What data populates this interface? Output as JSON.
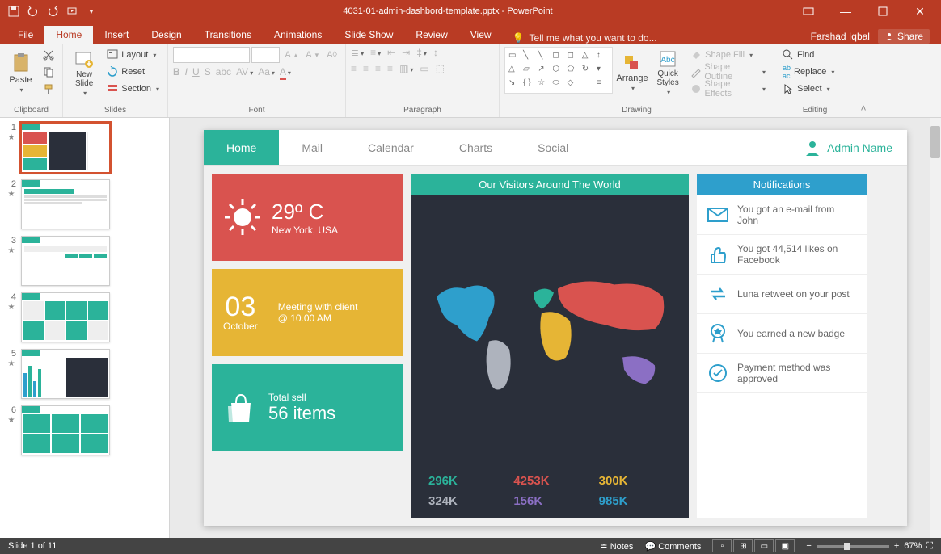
{
  "window": {
    "title": "4031-01-admin-dashbord-template.pptx - PowerPoint",
    "user": "Farshad Iqbal",
    "share": "Share"
  },
  "tabs": {
    "file": "File",
    "list": [
      "Home",
      "Insert",
      "Design",
      "Transitions",
      "Animations",
      "Slide Show",
      "Review",
      "View"
    ],
    "active": "Home",
    "tell_me": "Tell me what you want to do..."
  },
  "ribbon": {
    "clipboard": {
      "label": "Clipboard",
      "paste": "Paste"
    },
    "slides": {
      "label": "Slides",
      "new_slide": "New\nSlide",
      "layout": "Layout",
      "reset": "Reset",
      "section": "Section"
    },
    "font": {
      "label": "Font"
    },
    "paragraph": {
      "label": "Paragraph"
    },
    "drawing": {
      "label": "Drawing",
      "arrange": "Arrange",
      "quick_styles": "Quick\nStyles",
      "shape_fill": "Shape Fill",
      "shape_outline": "Shape Outline",
      "shape_effects": "Shape Effects"
    },
    "editing": {
      "label": "Editing",
      "find": "Find",
      "replace": "Replace",
      "select": "Select"
    }
  },
  "dashboard": {
    "nav": [
      "Home",
      "Mail",
      "Calendar",
      "Charts",
      "Social"
    ],
    "nav_active": "Home",
    "admin": "Admin Name",
    "weather": {
      "temp": "29º C",
      "loc": "New York, USA"
    },
    "meeting": {
      "day": "03",
      "month": "October",
      "text": "Meeting with client @ 10.00 AM"
    },
    "shop": {
      "label": "Total sell",
      "value": "56 items"
    },
    "visitors_title": "Our Visitors Around The World",
    "stats": [
      {
        "v": "296K",
        "c": "#2bb39a"
      },
      {
        "v": "4253K",
        "c": "#d9534f"
      },
      {
        "v": "300K",
        "c": "#e6b535"
      },
      {
        "v": "324K",
        "c": "#aeb3bd"
      },
      {
        "v": "156K",
        "c": "#8b6fc4"
      },
      {
        "v": "985K",
        "c": "#2e9fcc"
      }
    ],
    "notifications_title": "Notifications",
    "notifications": [
      "You got an e-mail from John",
      "You got 44,514 likes on Facebook",
      "Luna retweet on your post",
      "You earned a new badge",
      "Payment method was approved"
    ]
  },
  "status": {
    "slide": "Slide 1 of 11",
    "notes": "Notes",
    "comments": "Comments",
    "zoom": "67%"
  },
  "thumbs": {
    "count": 11
  }
}
